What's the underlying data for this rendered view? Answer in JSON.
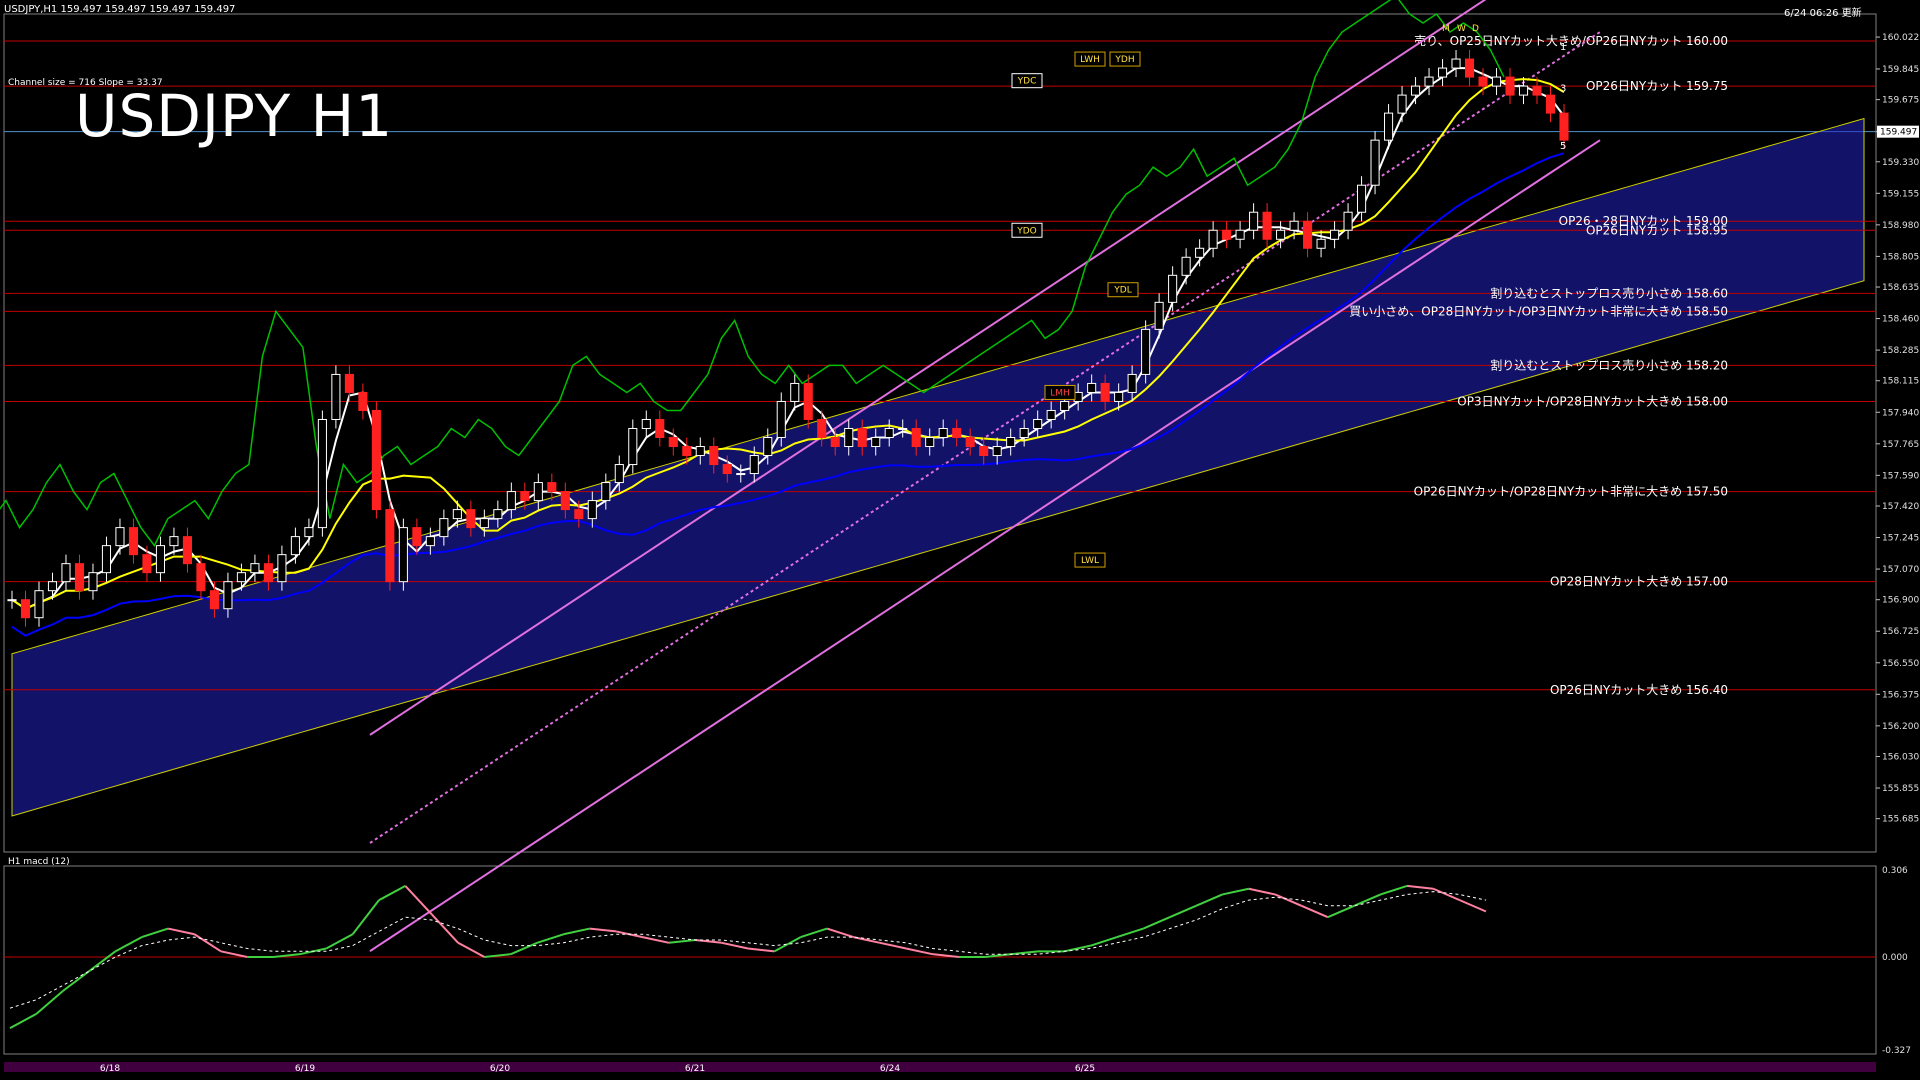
{
  "header": {
    "symbol_line": "USDJPY,H1  159.497 159.497 159.497 159.497",
    "channel_info": "Channel size = 716  Slope = 33.37",
    "title": "USDJPY H1",
    "updated": "6/24 06:26 更新",
    "current_price": "159.497"
  },
  "colors": {
    "background": "#000000",
    "grid": "#1e3c78",
    "hline": "#c00000",
    "bull": "#ffffff",
    "bear": "#ff2020",
    "tenkan": "#ffffff",
    "kijun": "#ffff00",
    "ma_slow": "#0000ff",
    "chikou": "#00c000",
    "cloud": "#2020c0",
    "channel": "#e070e0",
    "macd_up": "#40d040",
    "macd_down": "#ff80a0"
  },
  "chart_data": [
    {
      "type": "candlestick",
      "title": "USDJPY H1",
      "xlabel": "",
      "ylabel": "",
      "ylim": [
        155.5,
        160.15
      ],
      "x_ticks": [
        "6/18",
        "6/19",
        "6/20",
        "6/21",
        "6/24",
        "6/25"
      ],
      "y_ticks": [
        160.022,
        159.845,
        159.675,
        159.497,
        159.33,
        159.155,
        158.98,
        158.805,
        158.635,
        158.46,
        158.285,
        158.115,
        157.94,
        157.765,
        157.59,
        157.42,
        157.245,
        157.07,
        156.9,
        156.725,
        156.55,
        156.375,
        156.2,
        156.03,
        155.855,
        155.685
      ],
      "annotations": [
        {
          "text": "売り、OP25日NYカット大きめ/OP26日NYカット 160.00",
          "price": 160.0
        },
        {
          "text": "OP26日NYカット 159.75",
          "price": 159.75
        },
        {
          "text": "OP26・28日NYカット 159.00",
          "price": 159.0
        },
        {
          "text": "OP26日NYカット 158.95",
          "price": 158.95
        },
        {
          "text": "割り込むとストップロス売り小さめ 158.60",
          "price": 158.6
        },
        {
          "text": "買い小さめ、OP28日NYカット/OP3日NYカット非常に大きめ 158.50",
          "price": 158.5
        },
        {
          "text": "割り込むとストップロス売り小さめ 158.20",
          "price": 158.2
        },
        {
          "text": "OP3日NYカット/OP28日NYカット大きめ 158.00",
          "price": 158.0
        },
        {
          "text": "OP26日NYカット/OP28日NYカット非常に大きめ 157.50",
          "price": 157.5
        },
        {
          "text": "OP28日NYカット大きめ 157.00",
          "price": 157.0
        },
        {
          "text": "OP26日NYカット大きめ 156.40",
          "price": 156.4
        }
      ],
      "level_labels": [
        "LWH",
        "YDH",
        "YDC",
        "YDO",
        "YDL",
        "LWL",
        "LMH",
        "M",
        "W",
        "D"
      ],
      "pivot_markers": [
        "1",
        "3",
        "5"
      ],
      "close": [
        156.9,
        156.8,
        156.95,
        157.0,
        157.1,
        156.95,
        157.05,
        157.2,
        157.3,
        157.15,
        157.05,
        157.2,
        157.25,
        157.1,
        156.95,
        156.85,
        157.0,
        157.05,
        157.1,
        157.0,
        157.15,
        157.25,
        157.3,
        157.9,
        158.15,
        158.05,
        157.95,
        157.4,
        157.0,
        157.3,
        157.2,
        157.25,
        157.35,
        157.4,
        157.3,
        157.35,
        157.4,
        157.5,
        157.45,
        157.55,
        157.5,
        157.4,
        157.35,
        157.45,
        157.55,
        157.65,
        157.85,
        157.9,
        157.8,
        157.75,
        157.7,
        157.75,
        157.65,
        157.6,
        157.6,
        157.7,
        157.8,
        158.0,
        158.1,
        157.9,
        157.8,
        157.75,
        157.85,
        157.75,
        157.8,
        157.85,
        157.85,
        157.75,
        157.8,
        157.85,
        157.8,
        157.75,
        157.7,
        157.75,
        157.8,
        157.85,
        157.9,
        157.95,
        158.0,
        158.05,
        158.1,
        158.0,
        158.05,
        158.15,
        158.4,
        158.55,
        158.7,
        158.8,
        158.85,
        158.95,
        158.9,
        158.95,
        159.05,
        158.9,
        158.95,
        159.0,
        158.85,
        158.9,
        158.95,
        159.05,
        159.2,
        159.45,
        159.6,
        159.7,
        159.75,
        159.8,
        159.85,
        159.9,
        159.8,
        159.75,
        159.8,
        159.7,
        159.75,
        159.7,
        159.6,
        159.45
      ],
      "series": [
        {
          "name": "",
          "role": "tenkan"
        },
        {
          "name": "",
          "role": "kijun"
        },
        {
          "name": "",
          "role": "ma_slow"
        },
        {
          "name": "",
          "role": "chikou"
        },
        {
          "name": "",
          "role": "cloud"
        }
      ]
    },
    {
      "type": "line",
      "title": "H1  macd (12)",
      "xlabel": "",
      "ylabel": "",
      "ylim": [
        -0.327,
        0.306
      ],
      "y_ticks": [
        0.306,
        0.0,
        -0.327
      ],
      "series": [
        {
          "name": "",
          "role": "macd",
          "values": [
            -0.25,
            -0.2,
            -0.12,
            -0.05,
            0.02,
            0.07,
            0.1,
            0.08,
            0.02,
            0.0,
            0.0,
            0.01,
            0.03,
            0.08,
            0.2,
            0.25,
            0.15,
            0.05,
            0.0,
            0.01,
            0.05,
            0.08,
            0.1,
            0.09,
            0.07,
            0.05,
            0.06,
            0.05,
            0.03,
            0.02,
            0.07,
            0.1,
            0.07,
            0.05,
            0.03,
            0.01,
            0.0,
            0.0,
            0.01,
            0.02,
            0.02,
            0.04,
            0.07,
            0.1,
            0.14,
            0.18,
            0.22,
            0.24,
            0.22,
            0.18,
            0.14,
            0.18,
            0.22,
            0.25,
            0.24,
            0.2,
            0.16
          ]
        },
        {
          "name": "",
          "role": "signal",
          "values": [
            -0.18,
            -0.15,
            -0.1,
            -0.05,
            0.0,
            0.04,
            0.06,
            0.07,
            0.05,
            0.03,
            0.02,
            0.02,
            0.02,
            0.04,
            0.09,
            0.14,
            0.13,
            0.1,
            0.06,
            0.04,
            0.04,
            0.05,
            0.07,
            0.08,
            0.08,
            0.07,
            0.06,
            0.06,
            0.05,
            0.04,
            0.05,
            0.07,
            0.07,
            0.06,
            0.05,
            0.03,
            0.02,
            0.01,
            0.01,
            0.01,
            0.02,
            0.03,
            0.05,
            0.07,
            0.1,
            0.13,
            0.17,
            0.2,
            0.21,
            0.2,
            0.18,
            0.18,
            0.2,
            0.22,
            0.23,
            0.22,
            0.2
          ]
        }
      ]
    }
  ]
}
